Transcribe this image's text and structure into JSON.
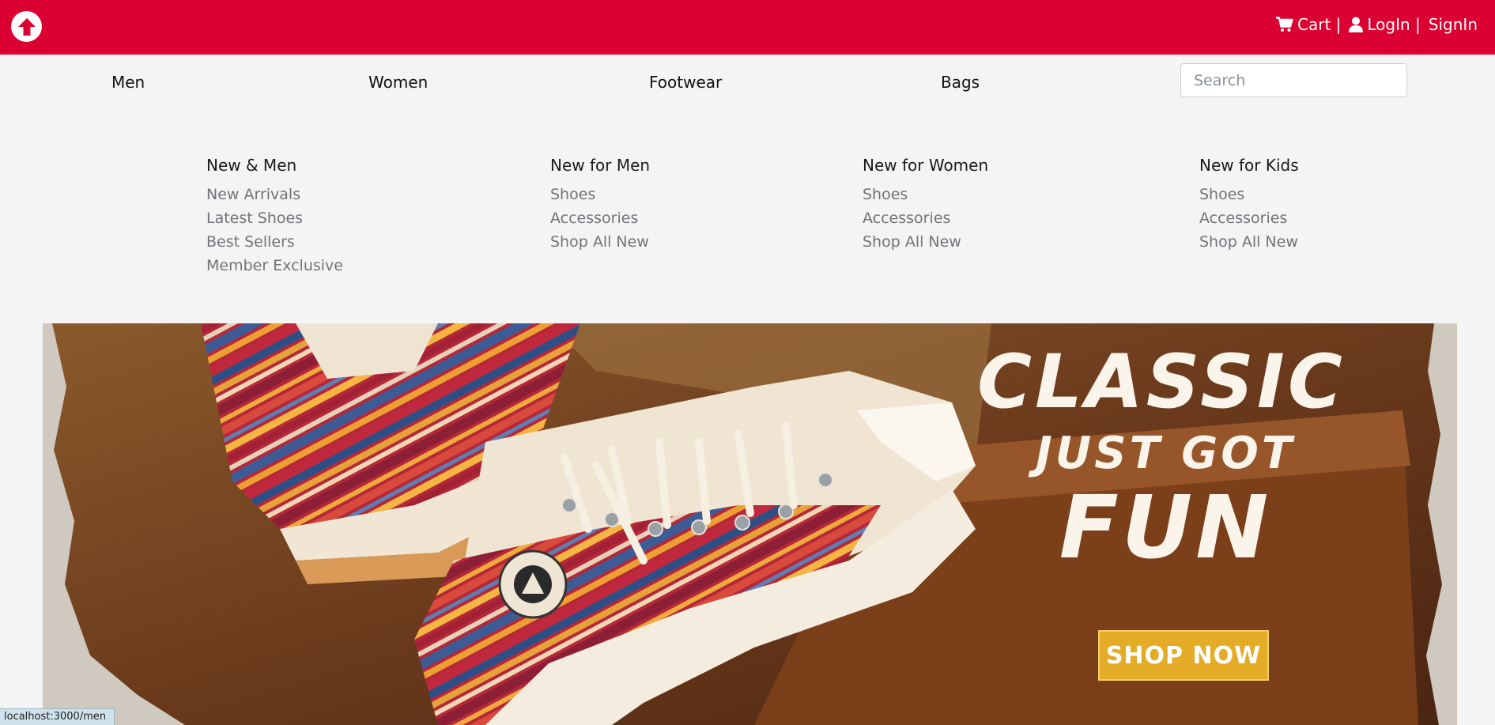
{
  "header": {
    "cart_label": "Cart |",
    "login_label": "LogIn |",
    "signin_label": "SignIn"
  },
  "nav": {
    "items": [
      "Men",
      "Women",
      "Footwear",
      "Bags"
    ],
    "search_placeholder": "Search"
  },
  "menu": {
    "columns": [
      {
        "title": "New & Men",
        "links": [
          "New Arrivals",
          "Latest Shoes",
          "Best Sellers",
          "Member Exclusive"
        ]
      },
      {
        "title": "New for Men",
        "links": [
          "Shoes",
          "Accessories",
          "Shop All New"
        ]
      },
      {
        "title": "New for Women",
        "links": [
          "Shoes",
          "Accessories",
          "Shop All New"
        ]
      },
      {
        "title": "New for Kids",
        "links": [
          "Shoes",
          "Accessories",
          "Shop All New"
        ]
      }
    ]
  },
  "banner": {
    "line1": "CLASSIC",
    "line2": "JUST GOT",
    "line3": "FUN",
    "cta": "SHOP NOW"
  },
  "status": {
    "url": "localhost:3000/men"
  },
  "colors": {
    "brand": "#db0032",
    "cta": "#e4ab26"
  }
}
